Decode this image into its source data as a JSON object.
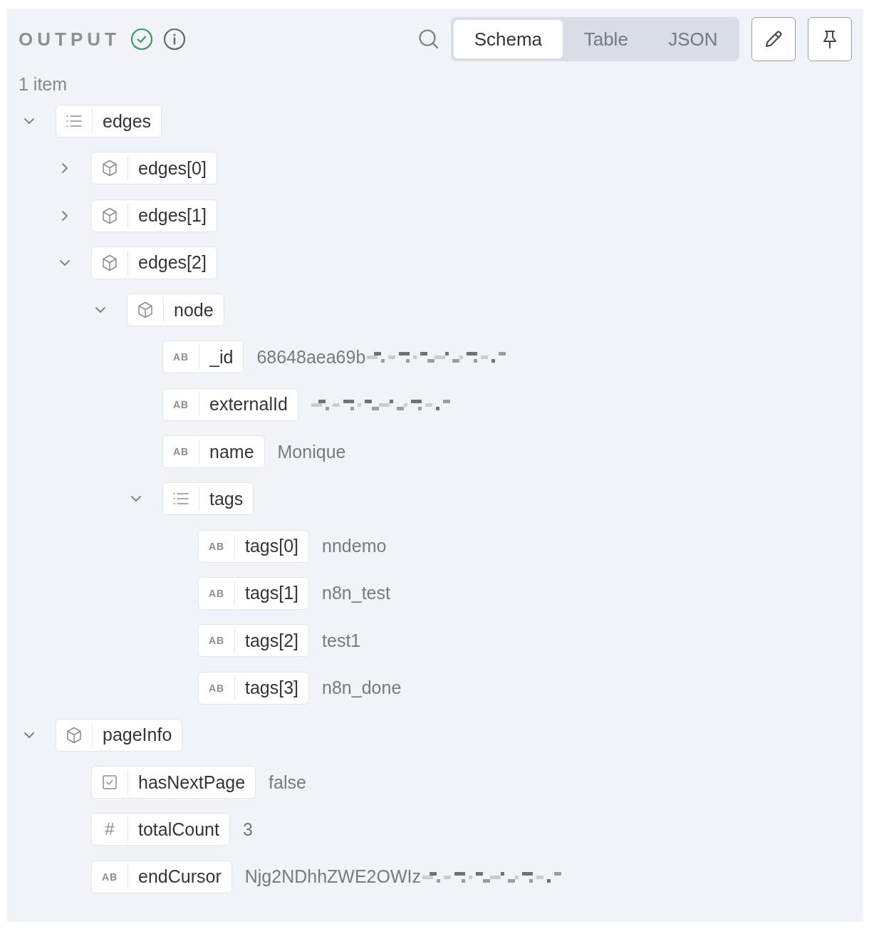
{
  "header": {
    "title": "OUTPUT"
  },
  "tabs": [
    {
      "label": "Schema",
      "selected": true
    },
    {
      "label": "Table",
      "selected": false
    },
    {
      "label": "JSON",
      "selected": false
    }
  ],
  "item_count": "1 item",
  "tree": [
    {
      "key": "edges",
      "kind": "array",
      "expanded": true,
      "children": [
        {
          "key": "edges[0]",
          "kind": "object",
          "expanded": false
        },
        {
          "key": "edges[1]",
          "kind": "object",
          "expanded": false
        },
        {
          "key": "edges[2]",
          "kind": "object",
          "expanded": true,
          "children": [
            {
              "key": "node",
              "kind": "object",
              "expanded": true,
              "children": [
                {
                  "key": "_id",
                  "kind": "string",
                  "type_glyph": "AB",
                  "value": "68648aea69b",
                  "redacted": true
                },
                {
                  "key": "externalId",
                  "kind": "string",
                  "type_glyph": "AB",
                  "redacted": true
                },
                {
                  "key": "name",
                  "kind": "string",
                  "type_glyph": "AB",
                  "value": "Monique"
                },
                {
                  "key": "tags",
                  "kind": "array",
                  "expanded": true,
                  "children": [
                    {
                      "key": "tags[0]",
                      "kind": "string",
                      "type_glyph": "AB",
                      "value": "nndemo"
                    },
                    {
                      "key": "tags[1]",
                      "kind": "string",
                      "type_glyph": "AB",
                      "value": "n8n_test"
                    },
                    {
                      "key": "tags[2]",
                      "kind": "string",
                      "type_glyph": "AB",
                      "value": "test1"
                    },
                    {
                      "key": "tags[3]",
                      "kind": "string",
                      "type_glyph": "AB",
                      "value": "n8n_done"
                    }
                  ]
                }
              ]
            }
          ]
        }
      ]
    },
    {
      "key": "pageInfo",
      "kind": "object",
      "expanded": true,
      "children": [
        {
          "key": "hasNextPage",
          "kind": "boolean",
          "value": "false"
        },
        {
          "key": "totalCount",
          "kind": "number",
          "type_glyph": "#",
          "value": "3"
        },
        {
          "key": "endCursor",
          "kind": "string",
          "type_glyph": "AB",
          "value": "Njg2NDhhZWE2OWIz",
          "redacted": true
        }
      ]
    }
  ]
}
